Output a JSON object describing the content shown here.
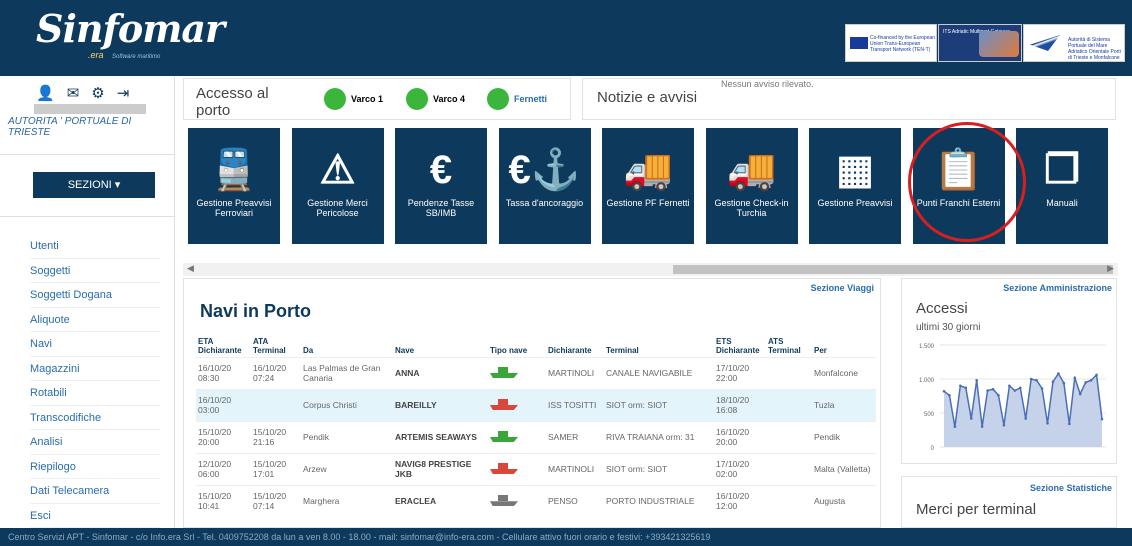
{
  "header": {
    "logo_text": "Sinfomar",
    "logo_suffix": ".era",
    "logo_tagline": "Software maritimo",
    "banner1_text": "Co-financed by the European Union Trans-European Transport Network (TEN-T)",
    "banner2_text": "ITS Adriatic Multiport Gateway",
    "banner3_text": "Autorità di Sistema Portuale del Mare Adriatico Orientale Porti di Trieste e Monfalcone"
  },
  "sidebar": {
    "authority": "AUTORITA ' PORTUALE DI TRIESTE",
    "sezioni_label": "SEZIONI ▾",
    "items": [
      {
        "label": "Utenti"
      },
      {
        "label": "Soggetti"
      },
      {
        "label": "Soggetti Dogana"
      },
      {
        "label": "Aliquote"
      },
      {
        "label": "Navi"
      },
      {
        "label": "Magazzini"
      },
      {
        "label": "Rotabili"
      },
      {
        "label": "Transcodifiche"
      },
      {
        "label": "Analisi"
      },
      {
        "label": "Riepilogo"
      },
      {
        "label": "Dati Telecamera"
      },
      {
        "label": "Esci"
      }
    ]
  },
  "access": {
    "title": "Accesso al porto",
    "varchi": [
      {
        "label": "Varco 1",
        "color": "#3cb53c"
      },
      {
        "label": "Varco 4",
        "color": "#3cb53c"
      },
      {
        "label": "Fernetti",
        "color": "#3cb53c"
      }
    ]
  },
  "notices": {
    "title": "Notizie e avvisi",
    "message": "Nessun avviso rilevato."
  },
  "tiles": [
    {
      "icon": "train-icon",
      "glyph": "🚆",
      "label": "Gestione Preavvisi Ferroviari"
    },
    {
      "icon": "warning-icon",
      "glyph": "⚠",
      "label": "Gestione Merci Pericolose"
    },
    {
      "icon": "euro-icon",
      "glyph": "€",
      "label": "Pendenze Tasse SB/IMB"
    },
    {
      "icon": "euro-anchor-icon",
      "glyph": "€⚓",
      "label": "Tassa d'ancoraggio"
    },
    {
      "icon": "truck-icon",
      "glyph": "🚚",
      "label": "Gestione PF Fernetti"
    },
    {
      "icon": "truck-icon",
      "glyph": "🚚",
      "label": "Gestione Check-in Turchia"
    },
    {
      "icon": "pallet-icon",
      "glyph": "▦",
      "label": "Gestione Preavvisi"
    },
    {
      "icon": "truck-clipboard-icon",
      "glyph": "📋",
      "label": "Punti Franchi Esterni"
    },
    {
      "icon": "manual-icon",
      "glyph": "❐",
      "label": "Manuali"
    }
  ],
  "navi": {
    "section_link": "Sezione Viaggi",
    "title": "Navi in Porto",
    "headers": {
      "eta": "ETA Dichiarante",
      "ata": "ATA Terminal",
      "da": "Da",
      "nave": "Nave",
      "tipo": "Tipo nave",
      "dich": "Dichiarante",
      "terminal": "Terminal",
      "ets": "ETS Dichiarante",
      "ats": "ATS Terminal",
      "per": "Per"
    },
    "rows": [
      {
        "eta_d": "16/10/20",
        "eta_t": "08:30",
        "ata_d": "16/10/20",
        "ata_t": "07:24",
        "da": "Las Palmas de Gran Canaria",
        "nave": "ANNA",
        "ship_color": "#3aa53a",
        "dich": "MARTINOLI",
        "terminal": "CANALE NAVIGABILE",
        "ets_d": "17/10/20",
        "ets_t": "22:00",
        "ats": "",
        "per": "Monfalcone"
      },
      {
        "eta_d": "16/10/20",
        "eta_t": "03:00",
        "ata_d": "",
        "ata_t": "",
        "da": "Corpus Christi",
        "nave": "BAREILLY",
        "ship_color": "#d9473c",
        "dich": "ISS TOSITTI",
        "terminal": "SIOT orm: SIOT",
        "ets_d": "18/10/20",
        "ets_t": "16:08",
        "ats": "",
        "per": "Tuzla"
      },
      {
        "eta_d": "15/10/20",
        "eta_t": "20:00",
        "ata_d": "15/10/20",
        "ata_t": "21:16",
        "da": "Pendik",
        "nave": "ARTEMIS SEAWAYS",
        "ship_color": "#3aa53a",
        "dich": "SAMER",
        "terminal": "RIVA TRAIANA orm: 31",
        "ets_d": "16/10/20",
        "ets_t": "20:00",
        "ats": "",
        "per": "Pendik"
      },
      {
        "eta_d": "12/10/20",
        "eta_t": "06:00",
        "ata_d": "15/10/20",
        "ata_t": "17:01",
        "da": "Arzew",
        "nave": "NAVIG8 PRESTIGE JKB",
        "ship_color": "#d9473c",
        "dich": "MARTINOLI",
        "terminal": "SIOT orm: SIOT",
        "ets_d": "17/10/20",
        "ets_t": "02:00",
        "ats": "",
        "per": "Malta (Valletta)"
      },
      {
        "eta_d": "15/10/20",
        "eta_t": "10:41",
        "ata_d": "15/10/20",
        "ata_t": "07:14",
        "da": "Marghera",
        "nave": "ERACLEA",
        "ship_color": "#777777",
        "dich": "PENSO",
        "terminal": "PORTO INDUSTRIALE",
        "ets_d": "16/10/20",
        "ets_t": "12:00",
        "ats": "",
        "per": "Augusta"
      }
    ]
  },
  "admin": {
    "section_link": "Sezione Amministrazione",
    "title": "Accessi",
    "subtitle": "ultimi 30 giorni",
    "chart_data": {
      "type": "area",
      "title": "Accessi",
      "subtitle": "ultimi 30 giorni",
      "ylim": [
        0,
        1500
      ],
      "yticks": [
        "1.500",
        "1.000",
        "500",
        "0"
      ],
      "values": [
        820,
        760,
        300,
        900,
        870,
        420,
        980,
        300,
        830,
        850,
        760,
        320,
        900,
        830,
        870,
        420,
        1000,
        980,
        860,
        350,
        960,
        1080,
        940,
        340,
        1020,
        780,
        950,
        980,
        1060,
        410
      ],
      "color": "#4a6fb5"
    }
  },
  "stats": {
    "section_link": "Sezione Statistiche",
    "title": "Merci per terminal"
  },
  "footer": {
    "text": "Centro Servizi APT - Sinfomar - c/o Info.era Srl - Tel. 0409752208 da lun a ven 8.00 - 18.00 - mail: sinfomar@info-era.com - Cellulare attivo fuori orario e festivi: +393421325619"
  }
}
